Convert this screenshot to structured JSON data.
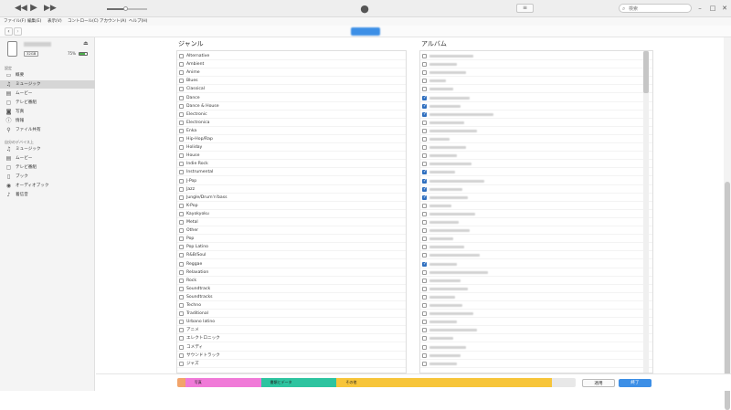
{
  "menu": {
    "file": "ファイル(F)",
    "edit": "編集(E)",
    "view": "表示(V)",
    "controls": "コントロール(C)",
    "account": "アカウント(A)",
    "help": "ヘルプ(H)"
  },
  "search": {
    "placeholder": "検索"
  },
  "device": {
    "capacity": "32GB",
    "battery": "75%"
  },
  "sidebar": {
    "settings_header": "設定",
    "settings": [
      {
        "label": "概要",
        "icon": "summary-icon"
      },
      {
        "label": "ミュージック",
        "icon": "music-icon",
        "selected": true
      },
      {
        "label": "ムービー",
        "icon": "film-icon"
      },
      {
        "label": "テレビ番組",
        "icon": "tv-icon"
      },
      {
        "label": "写真",
        "icon": "photo-icon"
      },
      {
        "label": "情報",
        "icon": "info-icon"
      },
      {
        "label": "ファイル共有",
        "icon": "share-icon"
      }
    ],
    "device_header": "自分のデバイス上",
    "ondevice": [
      {
        "label": "ミュージック",
        "icon": "music-icon"
      },
      {
        "label": "ムービー",
        "icon": "film-icon"
      },
      {
        "label": "テレビ番組",
        "icon": "tv-icon"
      },
      {
        "label": "ブック",
        "icon": "book-icon"
      },
      {
        "label": "オーディオブック",
        "icon": "audiobook-icon"
      },
      {
        "label": "着信音",
        "icon": "bell-icon"
      }
    ]
  },
  "genres": {
    "title": "ジャンル",
    "items": [
      {
        "label": "Alternative",
        "checked": false
      },
      {
        "label": "Ambient",
        "checked": false
      },
      {
        "label": "Anime",
        "checked": false
      },
      {
        "label": "Blues",
        "checked": false
      },
      {
        "label": "Classical",
        "checked": false
      },
      {
        "label": "Dance",
        "checked": false
      },
      {
        "label": "Dance & House",
        "checked": false
      },
      {
        "label": "Electronic",
        "checked": false
      },
      {
        "label": "Electronica",
        "checked": false
      },
      {
        "label": "Enka",
        "checked": false
      },
      {
        "label": "Hip-Hop/Rap",
        "checked": false
      },
      {
        "label": "Holiday",
        "checked": false
      },
      {
        "label": "House",
        "checked": false
      },
      {
        "label": "Indie Rock",
        "checked": false
      },
      {
        "label": "Instrumental",
        "checked": false
      },
      {
        "label": "J-Pop",
        "checked": false
      },
      {
        "label": "Jazz",
        "checked": false
      },
      {
        "label": "Jungle/Drum'n'bass",
        "checked": false
      },
      {
        "label": "K-Pop",
        "checked": false
      },
      {
        "label": "Kayokyoku",
        "checked": false
      },
      {
        "label": "Metal",
        "checked": false
      },
      {
        "label": "Other",
        "checked": false
      },
      {
        "label": "Pop",
        "checked": false
      },
      {
        "label": "Pop Latino",
        "checked": false
      },
      {
        "label": "R&B/Soul",
        "checked": false
      },
      {
        "label": "Reggae",
        "checked": false
      },
      {
        "label": "Relaxation",
        "checked": false
      },
      {
        "label": "Rock",
        "checked": false
      },
      {
        "label": "Soundtrack",
        "checked": false
      },
      {
        "label": "Soundtracks",
        "checked": false
      },
      {
        "label": "Techno",
        "checked": false
      },
      {
        "label": "Traditional",
        "checked": false
      },
      {
        "label": "Urbano latino",
        "checked": false
      },
      {
        "label": "アニメ",
        "checked": false
      },
      {
        "label": "エレクトロニック",
        "checked": false
      },
      {
        "label": "コメディ",
        "checked": false
      },
      {
        "label": "サウンドトラック",
        "checked": false
      },
      {
        "label": "ジャズ",
        "checked": false
      }
    ]
  },
  "albums": {
    "title": "アルバム",
    "checked": [
      false,
      false,
      false,
      false,
      false,
      true,
      true,
      true,
      false,
      false,
      false,
      false,
      false,
      false,
      true,
      true,
      true,
      true,
      false,
      false,
      false,
      false,
      false,
      false,
      false,
      true,
      false,
      false,
      false,
      false,
      false,
      false,
      false,
      false,
      false,
      false,
      false,
      false
    ]
  },
  "capacity_bar": {
    "segments": [
      {
        "label": "",
        "color": "#f2a46a",
        "fraction": 0.02
      },
      {
        "label": "写真",
        "color": "#f07ad8",
        "fraction": 0.19
      },
      {
        "label": "書類とデータ",
        "color": "#2ec4a0",
        "fraction": 0.19
      },
      {
        "label": "その他",
        "color": "#f7c53a",
        "fraction": 0.54
      }
    ]
  },
  "buttons": {
    "apply": "適用",
    "done": "終了"
  },
  "colors": {
    "accent": "#3d8fe6",
    "check": "#2f6fbf"
  }
}
